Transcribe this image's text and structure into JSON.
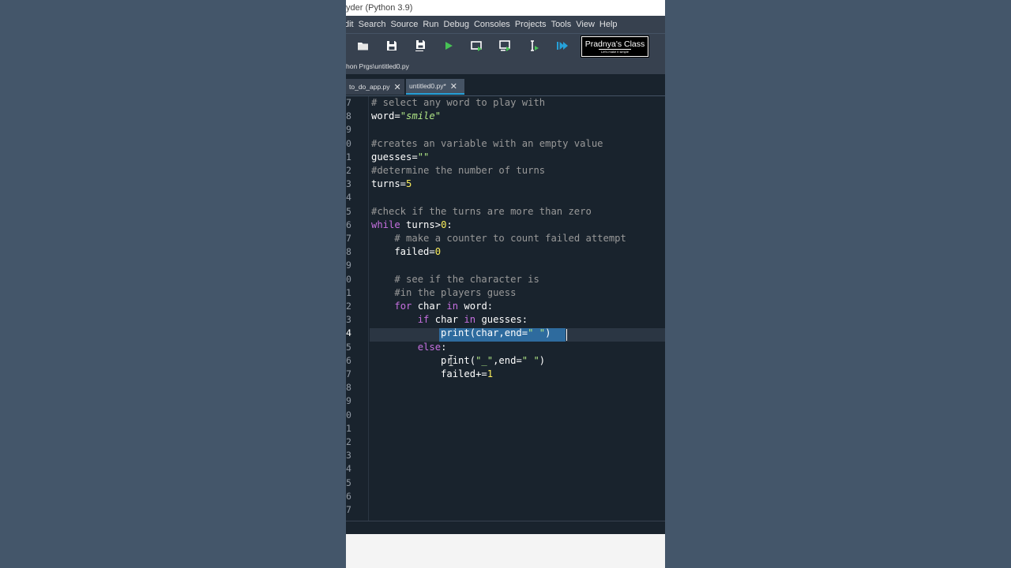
{
  "window": {
    "title": "yder (Python 3.9)"
  },
  "menu": [
    "dit",
    "Search",
    "Source",
    "Run",
    "Debug",
    "Consoles",
    "Projects",
    "Tools",
    "View",
    "Help"
  ],
  "toolbar": {
    "icons": [
      "open-folder-icon",
      "save-icon",
      "save-all-icon",
      "run-icon",
      "run-cell-icon",
      "run-cell-advance-icon",
      "run-selection-icon",
      "debug-icon"
    ]
  },
  "brand": {
    "title": "Pradnya's Class",
    "tagline": "Let's make it simple"
  },
  "path": "hon Prgs\\untitled0.py",
  "tabs": [
    {
      "label": "to_do_app.py",
      "close": "✕",
      "active": false
    },
    {
      "label": "untitled0.py*",
      "close": "✕",
      "active": true
    }
  ],
  "editor": {
    "current_line": "4",
    "line_numbers": [
      "7",
      "8",
      "9",
      "0",
      "1",
      "2",
      "3",
      "4",
      "5",
      "6",
      "7",
      "8",
      "9",
      "0",
      "1",
      "2",
      "3",
      "4",
      "5",
      "6",
      "7",
      "8",
      "9",
      "0",
      "1",
      "2",
      "3",
      "4",
      "5",
      "6",
      "7"
    ],
    "lines": [
      [
        {
          "t": "# select any word to play with",
          "c": "com"
        }
      ],
      [
        {
          "t": "word=",
          "c": "txt"
        },
        {
          "t": "\"smile\"",
          "c": "str-it"
        }
      ],
      [],
      [
        {
          "t": "#creates an variable with an empty value",
          "c": "com"
        }
      ],
      [
        {
          "t": "guesses=",
          "c": "txt"
        },
        {
          "t": "\"\"",
          "c": "str-it"
        }
      ],
      [
        {
          "t": "#determine the number of turns",
          "c": "com"
        }
      ],
      [
        {
          "t": "turns=",
          "c": "txt"
        },
        {
          "t": "5",
          "c": "num"
        }
      ],
      [],
      [
        {
          "t": "#check if the turns are more than zero",
          "c": "com"
        }
      ],
      [
        {
          "t": "while",
          "c": "kw"
        },
        {
          "t": " turns>",
          "c": "txt"
        },
        {
          "t": "0",
          "c": "num"
        },
        {
          "t": ":",
          "c": "txt"
        }
      ],
      [
        {
          "t": "    ",
          "c": "txt"
        },
        {
          "t": "# make a counter to count failed attempt",
          "c": "com"
        }
      ],
      [
        {
          "t": "    failed=",
          "c": "txt"
        },
        {
          "t": "0",
          "c": "num"
        }
      ],
      [],
      [
        {
          "t": "    ",
          "c": "txt"
        },
        {
          "t": "# see if the character is",
          "c": "com"
        }
      ],
      [
        {
          "t": "    ",
          "c": "txt"
        },
        {
          "t": "#in the players guess",
          "c": "com"
        }
      ],
      [
        {
          "t": "    ",
          "c": "txt"
        },
        {
          "t": "for",
          "c": "kw"
        },
        {
          "t": " char ",
          "c": "txt"
        },
        {
          "t": "in",
          "c": "kw"
        },
        {
          "t": " word:",
          "c": "txt"
        }
      ],
      [
        {
          "t": "        ",
          "c": "txt"
        },
        {
          "t": "if",
          "c": "kw"
        },
        {
          "t": " char ",
          "c": "txt"
        },
        {
          "t": "in",
          "c": "kw"
        },
        {
          "t": " guesses:",
          "c": "txt"
        }
      ],
      [
        {
          "t": "            print(char,end=",
          "c": "txt"
        },
        {
          "t": "\" \"",
          "c": "str"
        },
        {
          "t": ")",
          "c": "txt"
        }
      ],
      [
        {
          "t": "        ",
          "c": "txt"
        },
        {
          "t": "else",
          "c": "kw"
        },
        {
          "t": ":",
          "c": "txt"
        }
      ],
      [
        {
          "t": "            print(",
          "c": "txt"
        },
        {
          "t": "\"_\"",
          "c": "str"
        },
        {
          "t": ",end=",
          "c": "txt"
        },
        {
          "t": "\" \"",
          "c": "str"
        },
        {
          "t": ")",
          "c": "txt"
        }
      ],
      [
        {
          "t": "            failed+=",
          "c": "txt"
        },
        {
          "t": "1",
          "c": "num"
        }
      ],
      [],
      [],
      [],
      [],
      [],
      [],
      [],
      [],
      [],
      []
    ]
  },
  "colors": {
    "editor_bg": "#19232d",
    "panel_bg": "#37414f",
    "keyword": "#c670e0",
    "comment": "#999999",
    "number": "#faed5c",
    "string": "#b0e686",
    "selection": "#2e6b9e",
    "tab_accent": "#26a1d9"
  }
}
